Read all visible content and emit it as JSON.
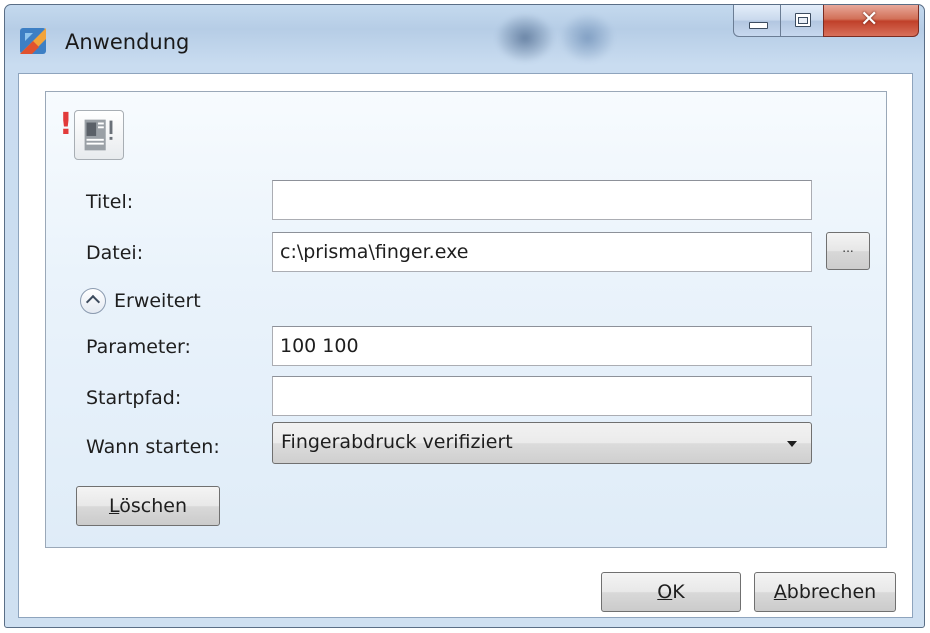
{
  "window": {
    "title": "Anwendung"
  },
  "form": {
    "title_label": "Titel:",
    "title_value": "",
    "file_label": "Datei:",
    "file_value": "c:\\prisma\\finger.exe",
    "browse_label": "...",
    "advanced_label": "Erweitert",
    "parameter_label": "Parameter:",
    "parameter_value": "100 100",
    "startpath_label": "Startpfad:",
    "startpath_value": "",
    "when_label": "Wann starten:",
    "when_value": "Fingerabdruck verifiziert",
    "delete_accel": "L",
    "delete_rest": "öschen"
  },
  "footer": {
    "ok_accel": "O",
    "ok_rest": "K",
    "cancel_accel": "A",
    "cancel_rest": "bbrechen"
  },
  "icons": {
    "app": "app-icon",
    "warning": "exclamation-icon",
    "document": "document-icon",
    "expander": "chevron-up-icon",
    "dropdown": "chevron-down-icon"
  },
  "colors": {
    "warning": "#e23a3a",
    "close_button": "#c0402a",
    "frame": "#c4d9ee"
  }
}
